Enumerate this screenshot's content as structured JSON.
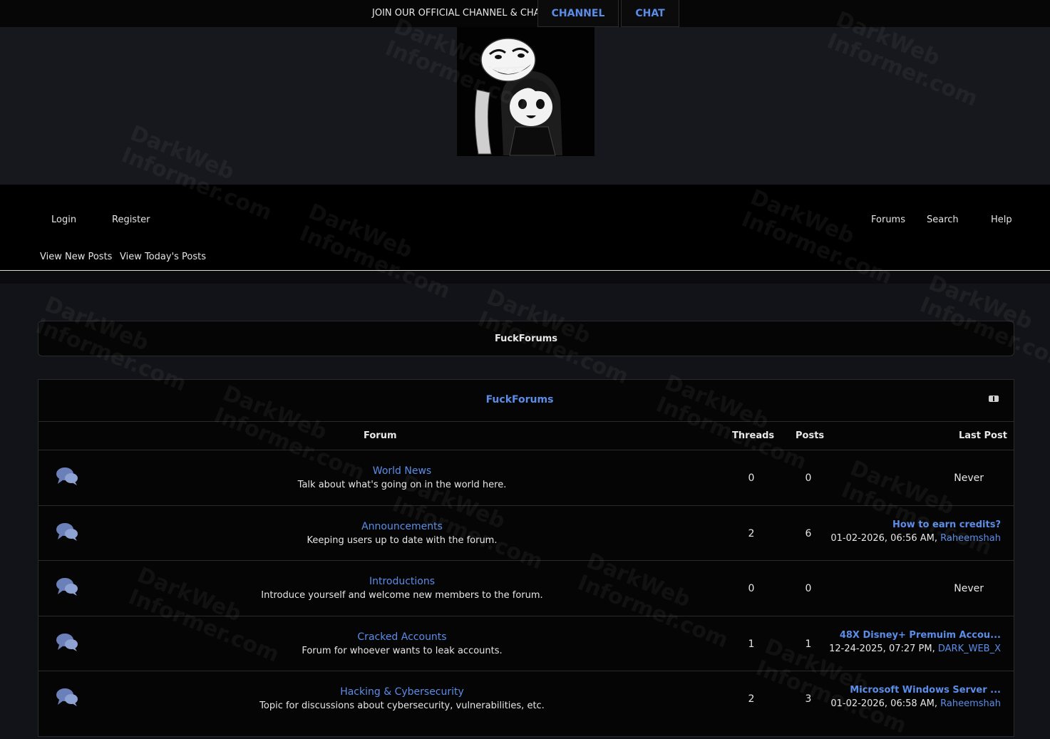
{
  "topbar": {
    "join_text": "JOIN OUR OFFICIAL CHANNEL & CHAT",
    "channel_label": "CHANNEL",
    "chat_label": "CHAT"
  },
  "nav": {
    "login": "Login",
    "register": "Register",
    "forums": "Forums",
    "search": "Search",
    "help": "Help",
    "new_posts": "View New Posts",
    "todays_posts": "View Today's Posts"
  },
  "board": {
    "title": "FuckForums"
  },
  "category": {
    "title": "FuckForums",
    "columns": {
      "forum": "Forum",
      "threads": "Threads",
      "posts": "Posts",
      "last_post": "Last Post"
    },
    "forums": [
      {
        "name": "World News",
        "desc": "Talk about what's going on in the world here.",
        "threads": "0",
        "posts": "0",
        "last_post_never": "Never"
      },
      {
        "name": "Announcements",
        "desc": "Keeping users up to date with the forum.",
        "threads": "2",
        "posts": "6",
        "lp_title": "How to earn credits?",
        "lp_date": "01-02-2026, 06:56 AM,",
        "lp_user": "Raheemshah"
      },
      {
        "name": "Introductions",
        "desc": "Introduce yourself and welcome new members to the forum.",
        "threads": "0",
        "posts": "0",
        "last_post_never": "Never"
      },
      {
        "name": "Cracked Accounts",
        "desc": "Forum for whoever wants to leak accounts.",
        "threads": "1",
        "posts": "1",
        "lp_title": "48X Disney+ Premuim Accou...",
        "lp_date": "12-24-2025, 07:27 PM,",
        "lp_user": "DARK_WEB_X"
      },
      {
        "name": "Hacking & Cybersecurity",
        "desc": "Topic for discussions about cybersecurity, vulnerabilities, etc.",
        "threads": "2",
        "posts": "3",
        "lp_title": "Microsoft Windows Server ...",
        "lp_date": "01-02-2026, 06:58 AM,",
        "lp_user": "Raheemshah"
      }
    ]
  },
  "watermark": {
    "line1": "DarkWeb",
    "line2": "Informer.com"
  },
  "colors": {
    "accent": "#5b8de8",
    "background": "#121318",
    "panel": "#050505"
  },
  "icons": {
    "forum_icon": "chat-bubbles-icon",
    "collapse_icon": "collapse-icon"
  }
}
